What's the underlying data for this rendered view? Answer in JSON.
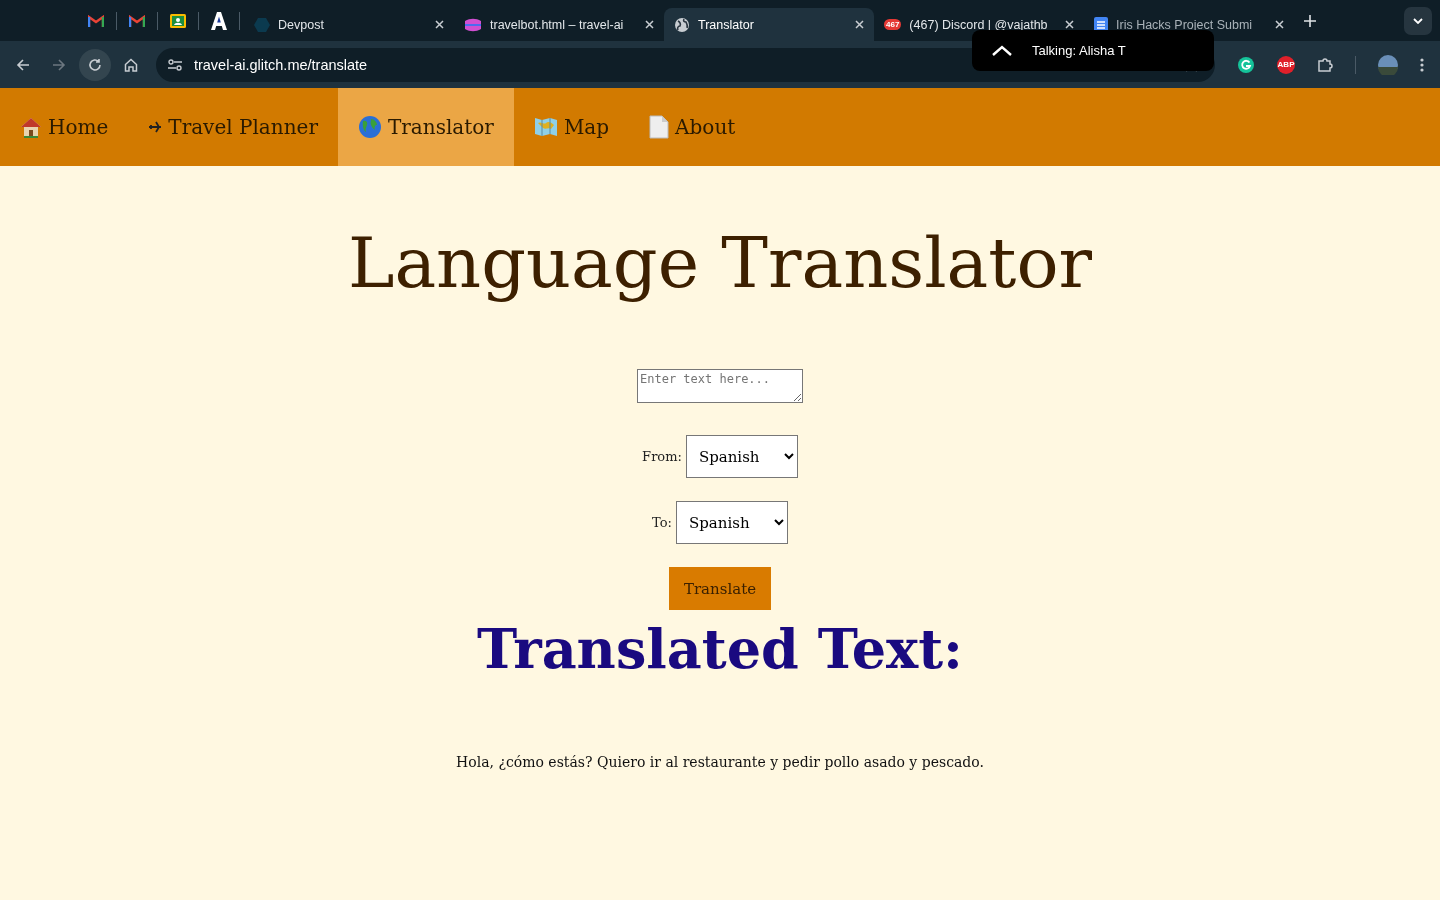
{
  "browser": {
    "tabs": [
      {
        "title": "Devpost",
        "selected": false,
        "faded": false
      },
      {
        "title": "travelbot.html – travel-ai",
        "selected": false,
        "faded": false
      },
      {
        "title": "Translator",
        "selected": true,
        "faded": false
      },
      {
        "title": "(467) Discord | @vajathb",
        "selected": false,
        "faded": false,
        "badge": "467"
      },
      {
        "title": "Iris Hacks Project Submi",
        "selected": false,
        "faded": true
      }
    ],
    "url": "travel-ai.glitch.me/translate",
    "extension_badge": "ABP",
    "tooltip": "Talking: Alisha T"
  },
  "nav": [
    {
      "label": "Home",
      "selected": false
    },
    {
      "label": "Travel Planner",
      "selected": false
    },
    {
      "label": "Translator",
      "selected": true
    },
    {
      "label": "Map",
      "selected": false
    },
    {
      "label": "About",
      "selected": false
    }
  ],
  "title": "Language Translator",
  "input": {
    "placeholder": "Enter text here..."
  },
  "from": {
    "label": "From:",
    "value": "Spanish"
  },
  "to": {
    "label": "To:",
    "value": "Spanish"
  },
  "button": "Translate",
  "result_heading": "Translated Text:",
  "result": "Hola, ¿cómo estás? Quiero ir al restaurante y pedir pollo asado y pescado."
}
